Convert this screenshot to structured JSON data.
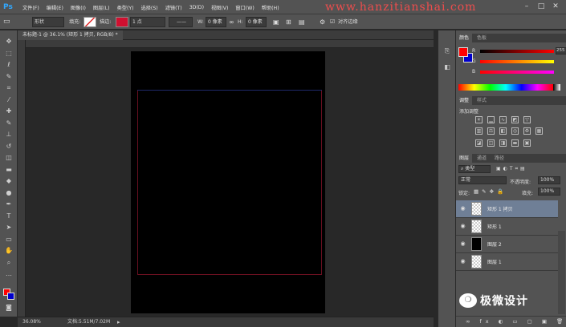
{
  "app": {
    "logo": "Ps",
    "watermark": "www.hanzitianshai.com"
  },
  "menu": [
    "文件(F)",
    "编辑(E)",
    "图像(I)",
    "图层(L)",
    "类型(Y)",
    "选择(S)",
    "滤镜(T)",
    "3D(D)",
    "视图(V)",
    "窗口(W)",
    "帮助(H)"
  ],
  "options": {
    "shape_mode": "形状",
    "fill_label": "填充:",
    "stroke_label": "描边:",
    "stroke_size": "1 点",
    "w_label": "W:",
    "w_value": "0 像素",
    "h_label": "H:",
    "h_value": "0 像素",
    "align_edges": "对齐边缘",
    "fill_color": "#ffffff",
    "stroke_color": "#d01030"
  },
  "document": {
    "tab_title": "未标题-1 @ 36.1% (矩形 1 拷贝, RGB/8) *",
    "zoom": "36.08%",
    "doc_size": "文档:5.51M/7.02M"
  },
  "color_panel": {
    "tabs": [
      "颜色",
      "色板"
    ],
    "r_label": "R",
    "g_label": "G",
    "b_label": "B",
    "r_value": "255",
    "g_value": "",
    "b_value": "",
    "fg_color": "#ff0000",
    "bg_color": "#0000cc"
  },
  "adjustments_panel": {
    "tabs": [
      "调整",
      "样式"
    ],
    "heading": "添加调整"
  },
  "layers_panel": {
    "tabs": [
      "图层",
      "通道",
      "路径"
    ],
    "filter_kind": "类型",
    "blend_mode": "正常",
    "opacity_label": "不透明度:",
    "opacity_value": "100%",
    "lock_label": "锁定:",
    "fill_label": "填充:",
    "fill_value": "100%",
    "layers": [
      {
        "name": "矩形 1 拷贝",
        "selected": true,
        "thumb": "transparent"
      },
      {
        "name": "矩形 1",
        "selected": false,
        "thumb": "transparent"
      },
      {
        "name": "图层 2",
        "selected": false,
        "thumb": "black"
      },
      {
        "name": "图层 1",
        "selected": false,
        "thumb": "transparent"
      }
    ]
  },
  "wechat": {
    "text": "极微设计",
    "icon": "wechat-icon"
  }
}
